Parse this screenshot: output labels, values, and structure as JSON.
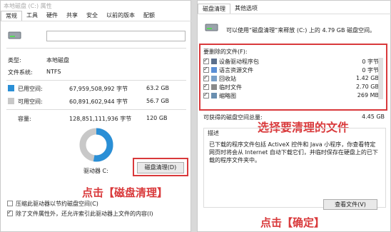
{
  "left": {
    "title": "本地磁盘 (C:) 属性",
    "tabs": [
      "常规",
      "工具",
      "硬件",
      "共享",
      "安全",
      "以前的版本",
      "配额"
    ],
    "type_label": "类型:",
    "type_value": "本地磁盘",
    "fs_label": "文件系统:",
    "fs_value": "NTFS",
    "used_label": "已用空间:",
    "used_bytes": "67,959,508,992 字节",
    "used_size": "63.2 GB",
    "free_label": "可用空间:",
    "free_bytes": "60,891,602,944 字节",
    "free_size": "56.7 GB",
    "cap_label": "容量:",
    "cap_bytes": "128,851,111,936 字节",
    "cap_size": "120 GB",
    "drive_label": "驱动器 C:",
    "cleanup_button": "磁盘清理(D)",
    "compress_label": "压缩此驱动器以节约磁盘空间(C)",
    "index_label": "除了文件属性外，还允许索引此驱动器上文件的内容(I)",
    "used_percent": 52.7,
    "colors": {
      "used": "#2a8fd6",
      "free": "#c8c8c8"
    }
  },
  "right": {
    "tabs": [
      "磁盘清理",
      "其他选项"
    ],
    "intro": "可以使用“磁盘清理”来释放 (C:) 上的 4.79 GB 磁盘空间。",
    "files_label": "要删除的文件(F):",
    "items": [
      {
        "name": "设备驱动程序包",
        "size": "0 字节",
        "checked": true,
        "icon": "driver-package-icon"
      },
      {
        "name": "语言资源文件",
        "size": "0 字节",
        "checked": true,
        "icon": "language-file-icon"
      },
      {
        "name": "回收站",
        "size": "1.42 GB",
        "checked": true,
        "icon": "recycle-bin-icon"
      },
      {
        "name": "临时文件",
        "size": "2.70 GB",
        "checked": true,
        "icon": "temp-file-icon"
      },
      {
        "name": "缩略图",
        "size": "269 MB",
        "checked": true,
        "icon": "thumbnail-icon"
      }
    ],
    "total_label": "可获得的磁盘空间总量:",
    "total_value": "4.45 GB",
    "desc_label": "描述",
    "desc_text": "已下载的程序文件包括 ActiveX 控件和 Java 小程序，你查看特定网页时将会从 Internet 自动下载它们，并临时保存在硬盘上的已下载的程序文件夹中。",
    "view_files_button": "查看文件(V)"
  },
  "annotations": {
    "click_cleanup": "点击【磁盘清理】",
    "select_files": "选择要清理的文件",
    "click_ok": "点击【确定】"
  }
}
